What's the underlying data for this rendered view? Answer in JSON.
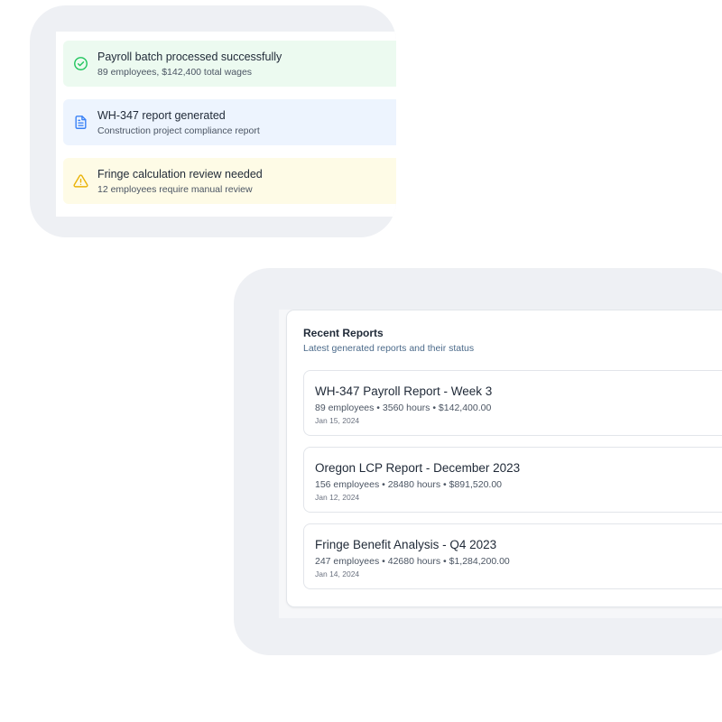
{
  "notifications": [
    {
      "type": "success",
      "icon": "check-circle-icon",
      "color": "#22c55e",
      "title": "Payroll batch processed successfully",
      "description": "89 employees, $142,400 total wages"
    },
    {
      "type": "info",
      "icon": "document-icon",
      "color": "#3b82f6",
      "title": "WH-347 report generated",
      "description": "Construction project compliance report"
    },
    {
      "type": "warning",
      "icon": "warning-triangle-icon",
      "color": "#eab308",
      "title": "Fringe calculation review needed",
      "description": "12 employees require manual review"
    }
  ],
  "recent_reports": {
    "title": "Recent Reports",
    "subtitle": "Latest generated reports and their status",
    "items": [
      {
        "name": "WH-347 Payroll Report - Week 3",
        "meta": "89 employees • 3560 hours • $142,400.00",
        "date": "Jan 15, 2024"
      },
      {
        "name": "Oregon LCP Report - December 2023",
        "meta": "156 employees • 28480 hours • $891,520.00",
        "date": "Jan 12, 2024"
      },
      {
        "name": "Fringe Benefit Analysis - Q4 2023",
        "meta": "247 employees • 42680 hours • $1,284,200.00",
        "date": "Jan 14, 2024"
      }
    ]
  }
}
